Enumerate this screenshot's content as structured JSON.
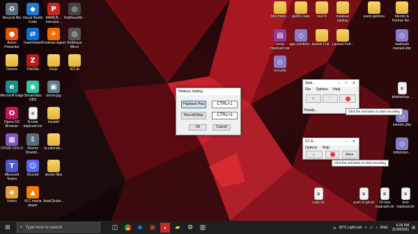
{
  "desktop_left": [
    {
      "label": "Recycle Bin",
      "glyph": "♻",
      "color": "#5a6b7a"
    },
    {
      "label": "Visual Studio Code",
      "glyph": "◆",
      "color": "#1f7ad4"
    },
    {
      "label": "MAMUK... microsoi...",
      "glyph": "P",
      "color": "#c62828"
    },
    {
      "label": "ReMouseM...",
      "glyph": "◎",
      "color": "#444"
    },
    {
      "label": "Active Presenter",
      "glyph": "●",
      "color": "#e65100"
    },
    {
      "label": "TeamViewer",
      "glyph": "⇄",
      "color": "#0e6fd1"
    },
    {
      "label": "Postman Agent",
      "glyph": "✈",
      "color": "#ef6c00"
    },
    {
      "label": "ReMouse Micro",
      "glyph": "◎",
      "color": "#555"
    },
    {
      "label": "Games",
      "glyph": "",
      "color": "folder"
    },
    {
      "label": "FileZilla",
      "glyph": "Z",
      "color": "#b71c1c"
    },
    {
      "label": "Kerje",
      "glyph": "",
      "color": "folder"
    },
    {
      "label": "ACLib",
      "glyph": "",
      "color": "folder"
    },
    {
      "label": "Microsoft Edge",
      "glyph": "e",
      "color": "#1a8c8c"
    },
    {
      "label": "Streamlabs OBS",
      "glyph": "◉",
      "color": "#31c3a2"
    },
    {
      "label": "doctor.jpg",
      "glyph": "▣",
      "color": "#607d8b"
    },
    {
      "label": "Opera GX Browser",
      "glyph": "O",
      "color": "#c2185b"
    },
    {
      "label": "fs-new madcash.txt",
      "glyph": "≡",
      "color": "file"
    },
    {
      "label": "kavakd",
      "glyph": "",
      "color": "folder"
    },
    {
      "label": "CPUID CPU-Z",
      "glyph": "▦",
      "color": "#7e57c2"
    },
    {
      "label": "Xtreme Downlo...",
      "glyph": "⇩",
      "color": "#546e7a"
    },
    {
      "label": "tu.calenda...",
      "glyph": "",
      "color": "folder"
    },
    {
      "label": "Microsoft Teams",
      "glyph": "T",
      "color": "#5059c9"
    },
    {
      "label": "Discord",
      "glyph": "☺",
      "color": "#5865f2"
    },
    {
      "label": "doctor-files",
      "glyph": "",
      "color": "folder"
    },
    {
      "label": "Vortex",
      "glyph": "◈",
      "color": "#e0a040"
    },
    {
      "label": "VLC media player",
      "glyph": "▲",
      "color": "#f57c00"
    },
    {
      "label": "AutoClicker...",
      "glyph": "",
      "color": "none"
    }
  ],
  "desktop_right": [
    {
      "label": "Merchlein...",
      "glyph": "",
      "color": "folder"
    },
    {
      "label": "gEMS-main",
      "glyph": "",
      "color": "folder"
    },
    {
      "label": "test-hi",
      "glyph": "",
      "color": "folder"
    },
    {
      "label": "mealsee backup",
      "glyph": "",
      "color": "folder"
    },
    {
      "label": "exels patches",
      "glyph": "",
      "color": "folder"
    },
    {
      "label": "Mentor & Partner Re...",
      "glyph": "",
      "color": "folder"
    },
    {
      "label": "mvoe madcash.rar",
      "glyph": "▤",
      "color": "#8d3b9c"
    },
    {
      "label": "app.combine...",
      "glyph": "◇",
      "color": "#8a7cc8"
    },
    {
      "label": "laravel-Full...",
      "glyph": "",
      "color": "folder"
    },
    {
      "label": "Laravel-Full...",
      "glyph": "",
      "color": "folder"
    },
    {
      "label": "madcash manual.php",
      "glyph": "◇",
      "color": "#8a7cc8"
    },
    {
      "label": "test.php",
      "glyph": "◇",
      "color": "#8a7cc8"
    },
    {
      "label": "phpbackup...",
      "glyph": "≡",
      "color": "file"
    },
    {
      "label": "sandon.php",
      "glyph": "◇",
      "color": "#8a7cc8"
    },
    {
      "label": "mdwsnpo...",
      "glyph": "◇",
      "color": "#8a7cc8"
    },
    {
      "label": "notjs.txt",
      "glyph": "≡",
      "color": "file"
    },
    {
      "label": "push to git.txt",
      "glyph": "≡",
      "color": "file"
    },
    {
      "label": "10-new madcash.txt",
      "glyph": "≡",
      "color": "file"
    },
    {
      "label": "new madcast.txt",
      "glyph": "≡",
      "color": "file"
    }
  ],
  "hotkeys_dialog": {
    "title": "Hotkeys Setting",
    "playback_label": "Playback Play",
    "playback_hotkey": "CTRL+1",
    "record_label": "Record/Stop",
    "record_hotkey": "CTRL+3",
    "ok_label": "Ok",
    "cancel_label": "Cancel"
  },
  "recorder_window_1": {
    "title": "Setti...",
    "menu": [
      "File",
      "Options",
      "Help"
    ],
    "status": "Ready...",
    "tooltip": "Click the red button to start recording"
  },
  "recorder_window_2": {
    "title": "GT A...",
    "menu": [
      "Options",
      "Help"
    ],
    "more_label": "More",
    "tooltip": "Click the red button to start recording"
  },
  "taskbar": {
    "search_placeholder": "Type here to search",
    "weather": "33°C  Light rain",
    "language": "ENG",
    "time": "5:29 PM",
    "date": "11/30/2021"
  },
  "colors": {
    "accent_red": "#d32020",
    "taskbar": "#1f1f1f"
  }
}
